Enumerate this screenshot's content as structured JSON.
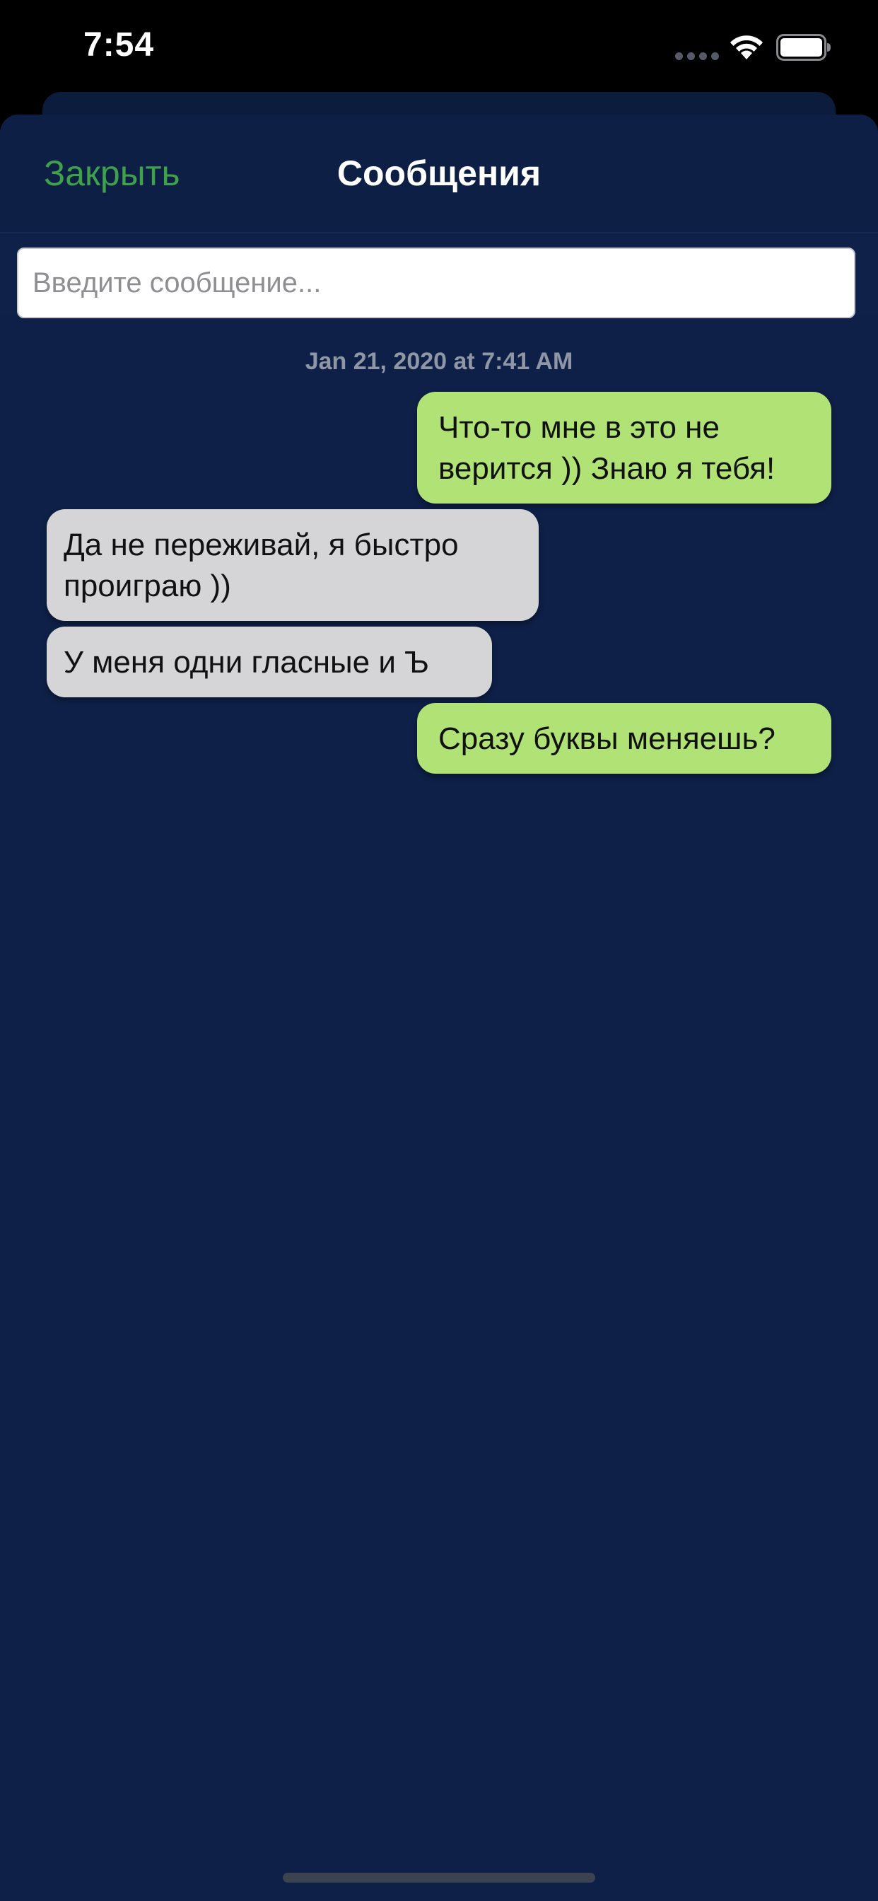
{
  "status_bar": {
    "time": "7:54",
    "signal_icon": "signal-dots-icon",
    "wifi_icon": "wifi-icon",
    "battery_icon": "battery-icon"
  },
  "header": {
    "close_label": "Закрыть",
    "title": "Сообщения"
  },
  "composer": {
    "placeholder": "Введите сообщение...",
    "value": ""
  },
  "conversation": {
    "timestamp": "Jan 21, 2020 at 7:41 AM",
    "messages": [
      {
        "direction": "outgoing",
        "text": "Что-то мне в это не верится )) Знаю я тебя!"
      },
      {
        "direction": "incoming",
        "text": "Да не переживай, я быстро проиграю ))"
      },
      {
        "direction": "incoming",
        "text": "У меня одни гласные и Ъ"
      },
      {
        "direction": "outgoing",
        "text": "Сразу буквы меняешь?"
      }
    ]
  },
  "colors": {
    "background": "#0e2047",
    "accent": "#3fa24a",
    "outgoing_bubble": "#b1e276",
    "incoming_bubble": "#d5d5d7"
  }
}
